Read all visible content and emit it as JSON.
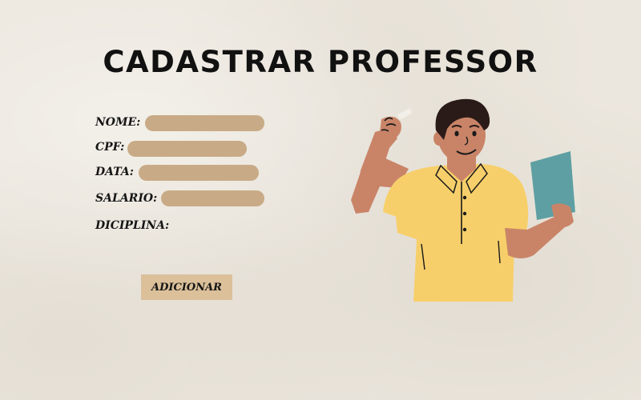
{
  "page": {
    "title": "CADASTRAR PROFESSOR"
  },
  "form": {
    "fields": [
      {
        "label": "NOME:",
        "value": ""
      },
      {
        "label": "CPF:",
        "value": ""
      },
      {
        "label": "DATA:",
        "value": ""
      },
      {
        "label": "SALARIO:",
        "value": ""
      }
    ],
    "disciplina_label": "DICIPLINA:",
    "submit_label": "ADICIONAR"
  },
  "colors": {
    "background": "#ece7de",
    "field_fill": "#c8ab86",
    "button_fill": "#dbc09a",
    "text": "#151515",
    "shirt": "#f7cf6a",
    "skin": "#c98468",
    "book": "#5e9fa3"
  },
  "illustration": {
    "icon": "teacher-holding-book-and-chalk-illustration"
  }
}
